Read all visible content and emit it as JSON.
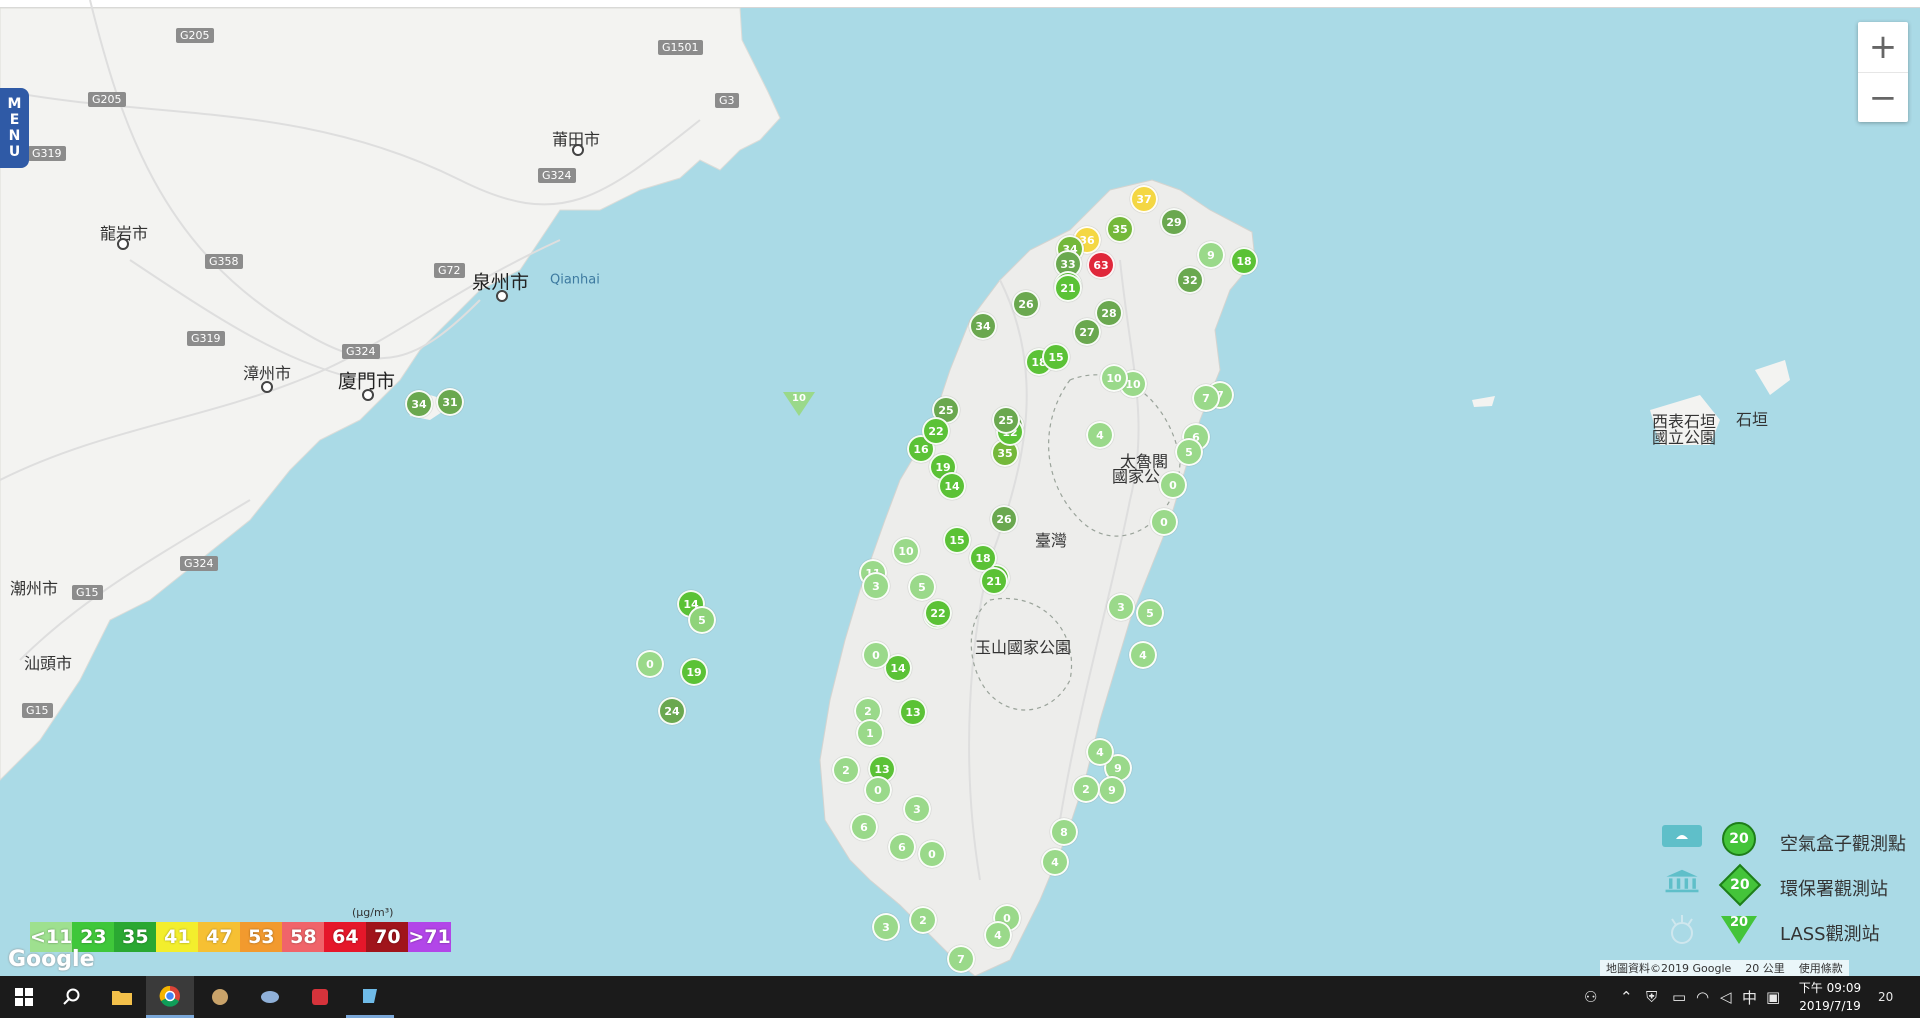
{
  "menu": {
    "label_chars": [
      "M",
      "E",
      "N",
      "U"
    ]
  },
  "zoom": {
    "in": "+",
    "out": "−"
  },
  "places": [
    {
      "name": "莆田市",
      "cls": ""
    },
    {
      "name": "龍岩市",
      "cls": ""
    },
    {
      "name": "泉州市",
      "cls": "big"
    },
    {
      "name": "Qianhai",
      "cls": "small"
    },
    {
      "name": "漳州市",
      "cls": ""
    },
    {
      "name": "廈門市",
      "cls": "big"
    },
    {
      "name": "潮州市",
      "cls": ""
    },
    {
      "name": "汕頭市",
      "cls": ""
    },
    {
      "name": "太魯閣",
      "cls": ""
    },
    {
      "name": "國家公",
      "cls": ""
    },
    {
      "name": "臺灣",
      "cls": ""
    },
    {
      "name": "玉山國家公園",
      "cls": ""
    },
    {
      "name": "石垣",
      "cls": ""
    },
    {
      "name": "西表石垣",
      "cls": ""
    },
    {
      "name": "國立公園",
      "cls": ""
    }
  ],
  "roads": [
    "G205",
    "G1501",
    "G205",
    "G319",
    "G3",
    "G324",
    "G358",
    "G72",
    "G319",
    "G324",
    "G324",
    "G15",
    "G15"
  ],
  "markers": [
    {
      "v": "63",
      "c": "#e0273a"
    },
    {
      "v": "37",
      "c": "#f4d743"
    },
    {
      "v": "36",
      "c": "#f4d743"
    },
    {
      "v": "35",
      "c": "#74b83a"
    },
    {
      "v": "34",
      "c": "#74b83a"
    },
    {
      "v": "33",
      "c": "#6aa84f"
    },
    {
      "v": "29",
      "c": "#6aa84f"
    },
    {
      "v": "28",
      "c": "#6aa84f"
    },
    {
      "v": "27",
      "c": "#6aa84f"
    },
    {
      "v": "26",
      "c": "#6aa84f"
    },
    {
      "v": "34",
      "c": "#6aa84f"
    },
    {
      "v": "34",
      "c": "#6aa84f"
    },
    {
      "v": "25",
      "c": "#6aa84f"
    },
    {
      "v": "22",
      "c": "#5bc236"
    },
    {
      "v": "21",
      "c": "#5bc236"
    },
    {
      "v": "18",
      "c": "#5bc236"
    },
    {
      "v": "15",
      "c": "#5bc236"
    },
    {
      "v": "35",
      "c": "#74b83a"
    },
    {
      "v": "26",
      "c": "#6aa84f"
    },
    {
      "v": "19",
      "c": "#5bc236"
    },
    {
      "v": "16",
      "c": "#5bc236"
    },
    {
      "v": "14",
      "c": "#5bc236"
    },
    {
      "v": "12",
      "c": "#5bc236"
    },
    {
      "v": "25",
      "c": "#6aa84f"
    },
    {
      "v": "22",
      "c": "#5bc236"
    },
    {
      "v": "21",
      "c": "#5bc236"
    },
    {
      "v": "18",
      "c": "#5bc236"
    },
    {
      "v": "21",
      "c": "#5bc236"
    },
    {
      "v": "22",
      "c": "#5bc236"
    },
    {
      "v": "14",
      "c": "#5bc236"
    },
    {
      "v": "13",
      "c": "#5bc236"
    },
    {
      "v": "34",
      "c": "#6aa84f"
    },
    {
      "v": "31",
      "c": "#6aa84f"
    },
    {
      "v": "14",
      "c": "#5bc236"
    },
    {
      "v": "5",
      "c": "#8fd37a"
    },
    {
      "v": "19",
      "c": "#5bc236"
    },
    {
      "v": "24",
      "c": "#6aa84f"
    },
    {
      "v": "0",
      "c": "#9ad98a"
    },
    {
      "v": "18",
      "c": "#5bc236"
    },
    {
      "v": "32",
      "c": "#6aa84f"
    },
    {
      "v": "9",
      "c": "#9ad98a"
    },
    {
      "v": "7",
      "c": "#9ad98a"
    },
    {
      "v": "6",
      "c": "#9ad98a"
    },
    {
      "v": "5",
      "c": "#9ad98a"
    },
    {
      "v": "4",
      "c": "#9ad98a"
    },
    {
      "v": "0",
      "c": "#9ad98a"
    },
    {
      "v": "0",
      "c": "#9ad98a"
    },
    {
      "v": "10",
      "c": "#9ad98a"
    },
    {
      "v": "3",
      "c": "#9ad98a"
    },
    {
      "v": "5",
      "c": "#9ad98a"
    },
    {
      "v": "4",
      "c": "#9ad98a"
    },
    {
      "v": "9",
      "c": "#9ad98a"
    },
    {
      "v": "9",
      "c": "#9ad98a"
    },
    {
      "v": "4",
      "c": "#9ad98a"
    },
    {
      "v": "2",
      "c": "#9ad98a"
    },
    {
      "v": "8",
      "c": "#9ad98a"
    },
    {
      "v": "4",
      "c": "#9ad98a"
    },
    {
      "v": "0",
      "c": "#9ad98a"
    },
    {
      "v": "4",
      "c": "#9ad98a"
    },
    {
      "v": "7",
      "c": "#9ad98a"
    },
    {
      "v": "2",
      "c": "#9ad98a"
    },
    {
      "v": "3",
      "c": "#9ad98a"
    },
    {
      "v": "13",
      "c": "#5bc236"
    },
    {
      "v": "0",
      "c": "#9ad98a"
    },
    {
      "v": "2",
      "c": "#9ad98a"
    },
    {
      "v": "1",
      "c": "#9ad98a"
    },
    {
      "v": "6",
      "c": "#9ad98a"
    },
    {
      "v": "0",
      "c": "#9ad98a"
    },
    {
      "v": "3",
      "c": "#9ad98a"
    },
    {
      "v": "11",
      "c": "#9ad98a"
    },
    {
      "v": "10",
      "c": "#9ad98a"
    },
    {
      "v": "5",
      "c": "#9ad98a"
    },
    {
      "v": "3",
      "c": "#9ad98a"
    },
    {
      "v": "0",
      "c": "#9ad98a"
    },
    {
      "v": "2",
      "c": "#9ad98a"
    },
    {
      "v": "6",
      "c": "#9ad98a"
    },
    {
      "v": "22",
      "c": "#5bc236"
    },
    {
      "v": "15",
      "c": "#5bc236"
    },
    {
      "v": "10",
      "c": "#9ad98a"
    },
    {
      "v": "7",
      "c": "#9ad98a"
    }
  ],
  "lass_point": {
    "v": "10"
  },
  "scale": {
    "unit": "(μg/m³)",
    "bins": [
      {
        "label": "<11",
        "color": "#9ee08f"
      },
      {
        "label": "23",
        "color": "#3fc73a"
      },
      {
        "label": "35",
        "color": "#2aa832"
      },
      {
        "label": "41",
        "color": "#f3ee2d"
      },
      {
        "label": "47",
        "color": "#f6c033"
      },
      {
        "label": "53",
        "color": "#f29a2e"
      },
      {
        "label": "58",
        "color": "#f0646a"
      },
      {
        "label": "64",
        "color": "#e5172a"
      },
      {
        "label": "70",
        "color": "#a0141b"
      },
      {
        "label": ">71",
        "color": "#b246e8"
      }
    ]
  },
  "legend": [
    {
      "label": "空氣盒子觀測點",
      "value": "20",
      "shape": "circle"
    },
    {
      "label": "環保署觀測站",
      "value": "20",
      "shape": "diamond"
    },
    {
      "label": "LASS觀測站",
      "value": "20",
      "shape": "triangle"
    }
  ],
  "google": "Google",
  "attribution": {
    "data": "地圖資料©2019 Google",
    "scale": "20 公里",
    "terms": "使用條款"
  },
  "taskbar": {
    "time": "下午 09:09",
    "date": "2019/7/19",
    "ime": "中",
    "notifications": "20",
    "apps": [
      "start-icon",
      "search-icon",
      "file-explorer-icon",
      "chrome-icon",
      "app-icon-1",
      "app-icon-2",
      "app-icon-3",
      "app-icon-4"
    ]
  },
  "colors": {
    "sea": "#aadae6",
    "land": "#f4f4f2",
    "taiwan": "#ececea",
    "accent": "#2f5aa6"
  }
}
